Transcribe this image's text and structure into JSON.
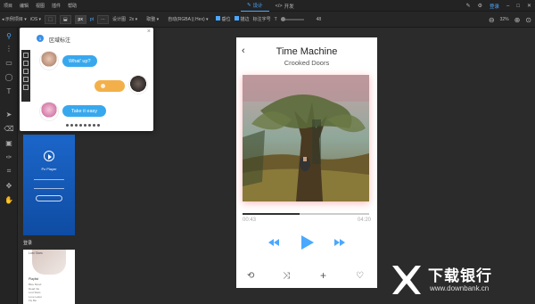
{
  "menubar": {
    "items": [
      "项目",
      "编辑",
      "视图",
      "插件",
      "帮助"
    ],
    "tabs": [
      {
        "label": "设计",
        "active": true
      },
      {
        "label": "开发",
        "active": false
      }
    ],
    "login_label": "登录"
  },
  "toolbar": {
    "project": "示例项目",
    "platform": "iOS",
    "unit_px": "px",
    "unit_pt": "pt",
    "design_label": "设计图",
    "design_scale": "2x",
    "color_label": "取整",
    "color_format": "自动(RGBA || Hex)",
    "check_position": "垂位",
    "check_border": "描边",
    "font_size_label": "标注字号",
    "font_size_value": "48",
    "zoom_value": "32%"
  },
  "popup": {
    "pin_number": "1",
    "title": "区域标注",
    "messages": [
      {
        "text": "What' up?",
        "side": "left",
        "color": "#38a8ee"
      },
      {
        "text": "",
        "side": "right",
        "color": "#f3b04a"
      },
      {
        "text": "Take it easy",
        "side": "left",
        "color": "#38a8ee"
      }
    ],
    "page_dot_count": 8
  },
  "artboards": {
    "player_title": "Pz Player",
    "login_label": "登录",
    "light_title": "Lost Stars",
    "light_heading": "Playlist",
    "light_rows": [
      "Blue Mood",
      "Dead Ink",
      "Lost Stars",
      "Love Letter",
      "Fly Me"
    ]
  },
  "player": {
    "song_title": "Time Machine",
    "artist": "Crooked Doors",
    "current_time": "00:43",
    "total_time": "04:20",
    "progress": 0.45,
    "accent_color": "#4aa8ff"
  },
  "watermark": {
    "title": "下载银行",
    "url": "www.downbank.cn"
  }
}
